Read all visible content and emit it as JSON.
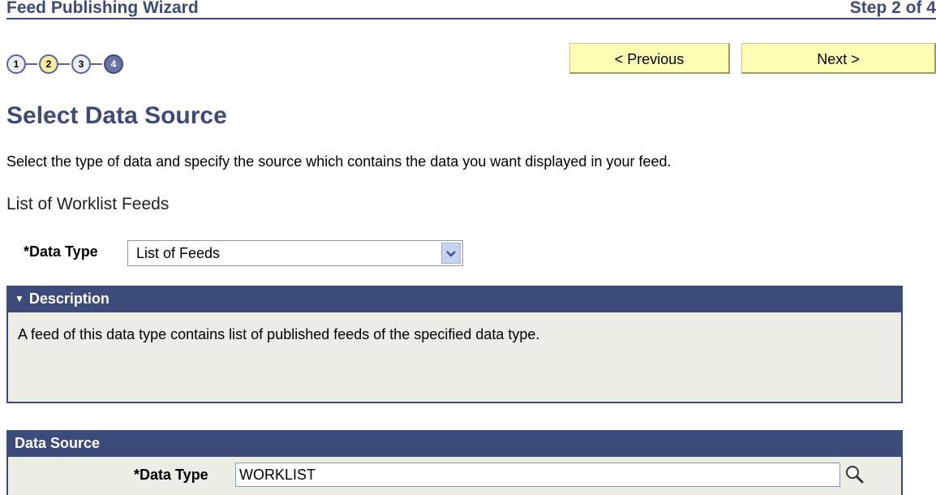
{
  "header": {
    "title": "Feed Publishing Wizard",
    "step_text": "Step 2 of 4"
  },
  "steps": [
    {
      "label": "1",
      "state": "completed"
    },
    {
      "label": "2",
      "state": "current"
    },
    {
      "label": "3",
      "state": "completed"
    },
    {
      "label": "4",
      "state": "future"
    }
  ],
  "nav": {
    "previous_label": "< Previous",
    "next_label": "Next >"
  },
  "page": {
    "title": "Select Data Source",
    "instructions": "Select the type of data and specify the source which contains the data you want displayed in your feed.",
    "feed_label": "List of Worklist Feeds"
  },
  "data_type_field": {
    "label": "*Data Type",
    "selected": "List of Feeds"
  },
  "description_panel": {
    "title": "Description",
    "text": "A feed of this data type contains list of published feeds of the specified data type."
  },
  "data_source_panel": {
    "title": "Data Source",
    "field_label": "*Data Type",
    "field_value": "WORKLIST"
  },
  "colors": {
    "accent": "#3d4b7b",
    "button_bg": "#ffffb3",
    "panel_bg": "#ecede5",
    "current_step": "#fbe9a0"
  },
  "icons": {
    "dropdown": "chevron-down-icon",
    "lookup": "magnifier-icon",
    "collapse": "triangle-down-icon"
  }
}
